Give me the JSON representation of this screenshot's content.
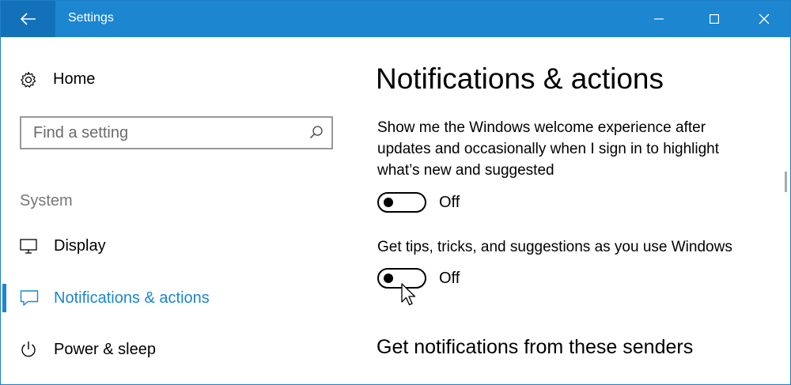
{
  "titlebar": {
    "title": "Settings",
    "back_icon": "arrow-left-icon",
    "minimize_icon": "minimize-icon",
    "maximize_icon": "maximize-icon",
    "close_icon": "close-icon",
    "accent": "#1c86d1",
    "back_bg": "#1271b8"
  },
  "sidebar": {
    "home_label": "Home",
    "search": {
      "placeholder": "Find a setting"
    },
    "section_label": "System",
    "items": [
      {
        "label": "Display",
        "icon": "monitor-icon",
        "active": false
      },
      {
        "label": "Notifications & actions",
        "icon": "notification-icon",
        "active": true
      },
      {
        "label": "Power & sleep",
        "icon": "power-icon",
        "active": false
      }
    ]
  },
  "main": {
    "title": "Notifications & actions",
    "settings": [
      {
        "description_lines": [
          "Show me the Windows welcome experience after",
          "updates and occasionally when I sign in to highlight",
          "what’s new and suggested"
        ],
        "state": "Off"
      },
      {
        "description_lines": [
          "Get tips, tricks, and suggestions as you use Windows"
        ],
        "state": "Off"
      }
    ],
    "senders_heading": "Get notifications from these senders"
  }
}
